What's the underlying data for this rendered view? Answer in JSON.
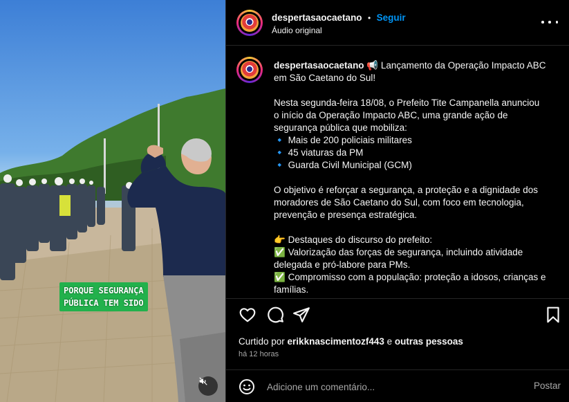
{
  "post": {
    "username": "despertasaocaetano",
    "separator": "•",
    "follow_label": "Seguir",
    "audio_label": "Áudio original"
  },
  "video": {
    "overlay_caption_line1": "PORQUE SEGURANÇA",
    "overlay_caption_line2": "PÚBLICA TEM SIDO"
  },
  "caption": {
    "username": "despertasaocaetano",
    "title_icon": "📢",
    "title_line1": " Lançamento da Operação Impacto ABC",
    "title_line2": "em São Caetano do Sul!",
    "para1": [
      "Nesta segunda-feira 18/08, o Prefeito Tite Campanella anunciou",
      "o início da Operação Impacto ABC, uma grande ação de",
      "segurança pública que mobiliza:"
    ],
    "bullets": [
      {
        "icon": "🔹",
        "text": " Mais de 200 policiais militares"
      },
      {
        "icon": "🔹",
        "text": " 45 viaturas da PM"
      },
      {
        "icon": "🔹",
        "text": " Guarda Civil Municipal (GCM)"
      }
    ],
    "para2": [
      "O objetivo é reforçar a segurança, a proteção e a dignidade dos",
      "moradores de São Caetano do Sul, com foco em tecnologia,",
      "prevenção e presença estratégica."
    ],
    "highlights_icon": "👉",
    "highlights_title": " Destaques do discurso do prefeito:",
    "check_icon": "✅",
    "highlight1_line1": " Valorização das forças de segurança, incluindo atividade",
    "highlight1_line2": "delegada e pró-labore para PMs.",
    "highlight2_line1": " Compromisso com a população: proteção a idosos, crianças e",
    "highlight2_line2": "famílias."
  },
  "engagement": {
    "liked_by_prefix": "Curtido por ",
    "liked_by_user": "erikknascimentozf443",
    "liked_by_mid": " e ",
    "liked_by_others": "outras pessoas",
    "timestamp": "há 12 horas"
  },
  "comment_box": {
    "placeholder": "Adicione um comentário...",
    "post_label": "Postar"
  },
  "icons": {
    "like": "heart-icon",
    "comment": "comment-icon",
    "share": "share-icon",
    "save": "bookmark-icon",
    "more": "more-icon",
    "emoji": "emoji-icon",
    "mute": "muted-speaker-icon"
  },
  "colors": {
    "accent": "#0095f6",
    "background": "#000000",
    "divider": "#262626",
    "muted_text": "#a8a8a8",
    "overlay_green": "#22b14c"
  }
}
